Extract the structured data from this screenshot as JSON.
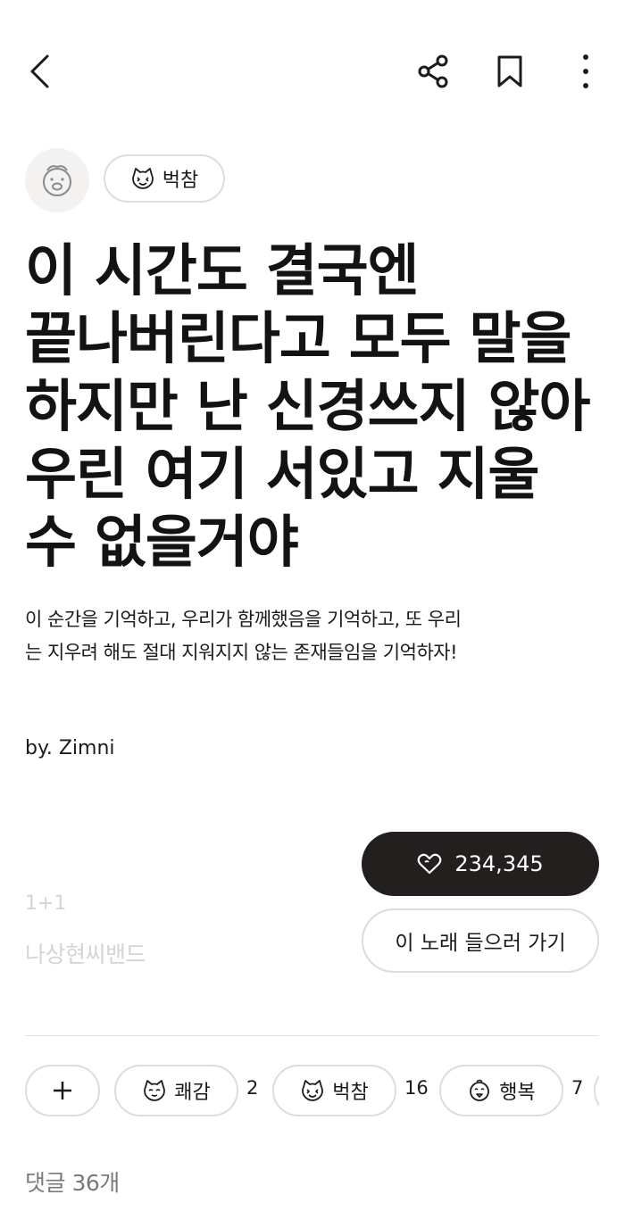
{
  "toolbar": {
    "back_icon": "chevron-left-icon",
    "share_icon": "share-icon",
    "bookmark_icon": "bookmark-icon",
    "more_icon": "more-vertical-icon"
  },
  "post": {
    "tag": "벅참",
    "title": "이 시간도 결국엔 끝나버린다고 모두 말을 하지만 난 신경쓰지 않아 우린 여기 서있고 지울 수 없을거야",
    "description": "이 순간을 기억하고, 우리가 함께했음을 기억하고, 또 우리는 지우려 해도 절대 지워지지 않는 존재들임을 기억하자!",
    "author": "by. Zimni"
  },
  "song": {
    "title": "1+1",
    "artist": "나상현씨밴드"
  },
  "actions": {
    "like_count": "234,345",
    "listen_label": "이 노래 들으러 가기"
  },
  "reactions": [
    {
      "label": "쾌감",
      "count": "2"
    },
    {
      "label": "벅참",
      "count": "16"
    },
    {
      "label": "행복",
      "count": "7"
    }
  ],
  "comments": {
    "label": "댓글 36개"
  },
  "colors": {
    "dark": "#231f1f",
    "muted": "#d4d4d4",
    "border": "#dcdcdc"
  }
}
